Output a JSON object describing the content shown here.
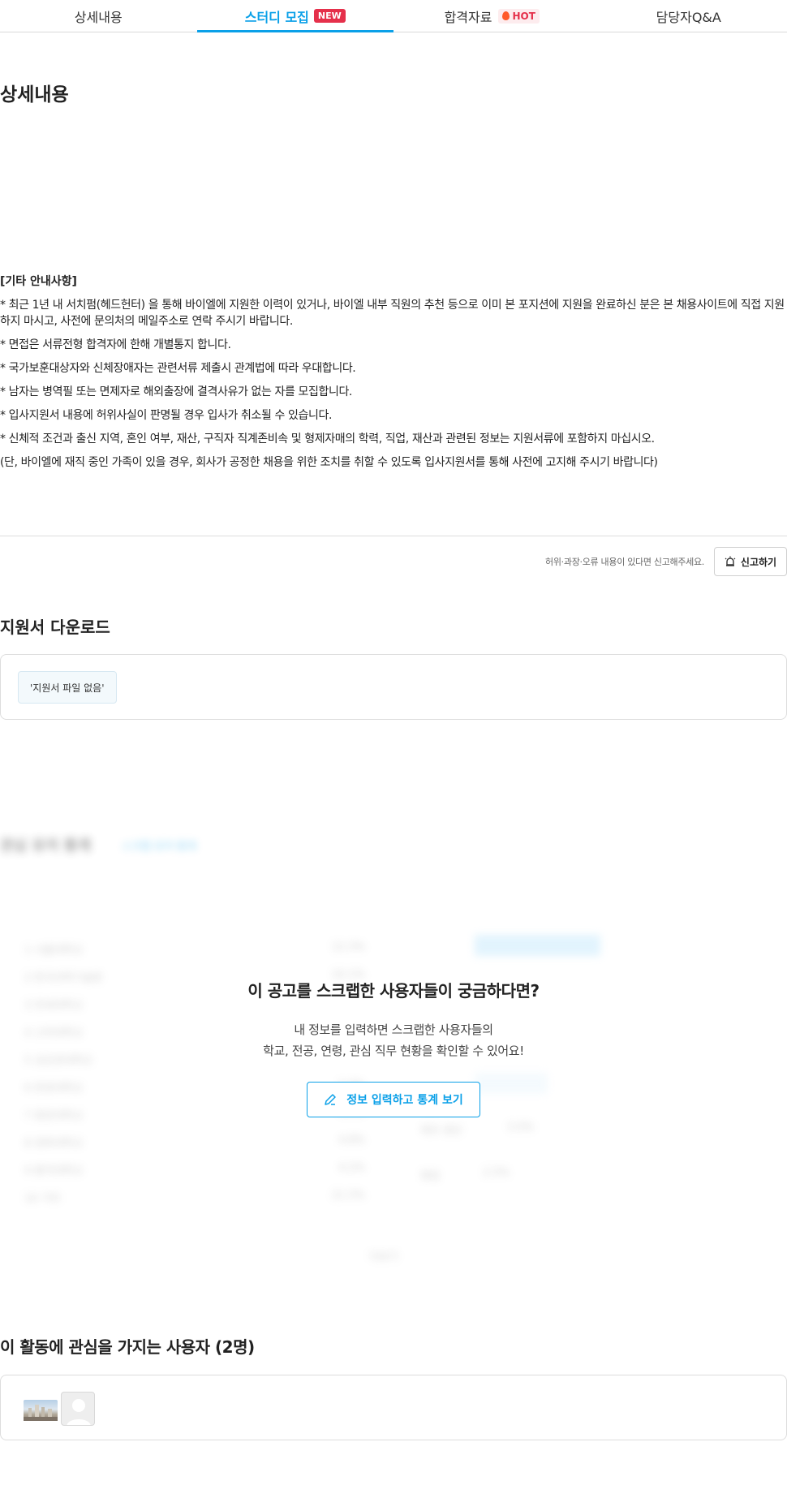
{
  "tabs": [
    {
      "label": "상세내용"
    },
    {
      "label": "스터디 모집",
      "badge": "NEW",
      "active": true
    },
    {
      "label": "합격자료",
      "badge": "HOT"
    },
    {
      "label": "담당자Q&A"
    }
  ],
  "detail": {
    "title": "상세내용",
    "notice_title": "[기타 안내사항]",
    "lines": [
      "* 최근 1년 내 서치펌(헤드헌터) 을 통해 바이엘에 지원한 이력이 있거나, 바이엘 내부 직원의 추천 등으로 이미 본 포지션에 지원을 완료하신 분은 본 채용사이트에 직접 지원하지 마시고, 사전에 문의처의 메일주소로 연락 주시기 바랍니다.",
      "* 면접은 서류전형 합격자에 한해 개별통지 합니다.",
      "* 국가보훈대상자와 신체장애자는 관련서류 제출시 관계법에 따라 우대합니다.",
      "* 남자는 병역필 또는 면제자로 해외출장에 결격사유가 없는 자를 모집합니다.",
      "* 입사지원서 내용에 허위사실이 판명될 경우 입사가 취소될 수 있습니다.",
      "* 신체적 조건과 출신 지역, 혼인 여부, 재산, 구직자 직계존비속 및 형제자매의 학력, 직업, 재산과 관련된 정보는 지원서류에 포함하지 마십시오.",
      "(단, 바이엘에 재직 중인 가족이 있을 경우, 회사가 공정한 채용을 위한 조치를 취할 수 있도록 입사지원서를 통해 사전에 고지해 주시기 바랍니다)"
    ]
  },
  "report": {
    "text": "허위·과장·오류 내용이 있다면 신고해주세요.",
    "button": "신고하기"
  },
  "download": {
    "title": "지원서 다운로드",
    "empty": "'지원서 파일 없음'"
  },
  "locked_stats": {
    "title": "이 공고를 스크랩한 사용자들이 궁금하다면?",
    "desc_line1": "내 정보를 입력하면 스크랩한 사용자들의",
    "desc_line2": "학교, 전공, 연령, 관심 직무 현황을 확인할 수 있어요!",
    "button": "정보 입력하고 통계 보기"
  },
  "interest": {
    "title": "이 활동에 관심을 가지는 사용자 (2명)"
  },
  "colors": {
    "accent": "#0aa0e8",
    "new_badge": "#e5304b"
  }
}
